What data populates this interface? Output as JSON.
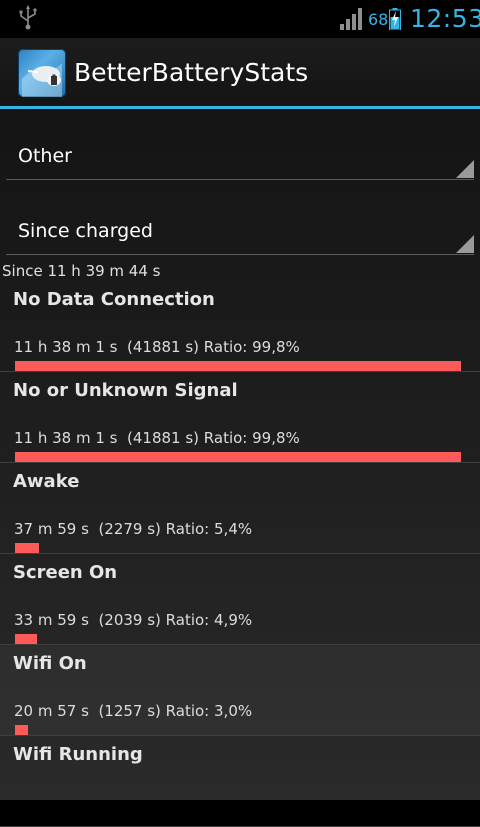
{
  "status_bar": {
    "battery_percent": "68",
    "time": "12:53",
    "accent": "#33b5e5",
    "icons": [
      "usb-icon",
      "signal-icon",
      "battery-charging-icon"
    ]
  },
  "action_bar": {
    "title": "BetterBatteryStats",
    "icon": "app-icon"
  },
  "spinners": [
    {
      "label": "Other"
    },
    {
      "label": "Since charged"
    }
  ],
  "since_text": "Since 11 h 39 m 44 s",
  "bar_color": "#ff5a5a",
  "rows": [
    {
      "title": "No Data Connection",
      "stats": "11 h 38 m 1 s  (41881 s) Ratio: 99,8%",
      "ratio": 0.998
    },
    {
      "title": "No or Unknown Signal",
      "stats": "11 h 38 m 1 s  (41881 s) Ratio: 99,8%",
      "ratio": 0.998
    },
    {
      "title": "Awake",
      "stats": "37 m 59 s  (2279 s) Ratio: 5,4%",
      "ratio": 0.054
    },
    {
      "title": "Screen On",
      "stats": "33 m 59 s  (2039 s) Ratio: 4,9%",
      "ratio": 0.049
    },
    {
      "title": "Wifi On",
      "stats": "20 m 57 s  (1257 s) Ratio: 3,0%",
      "ratio": 0.03
    },
    {
      "title": "Wifi Running",
      "stats": "",
      "ratio": null
    }
  ]
}
